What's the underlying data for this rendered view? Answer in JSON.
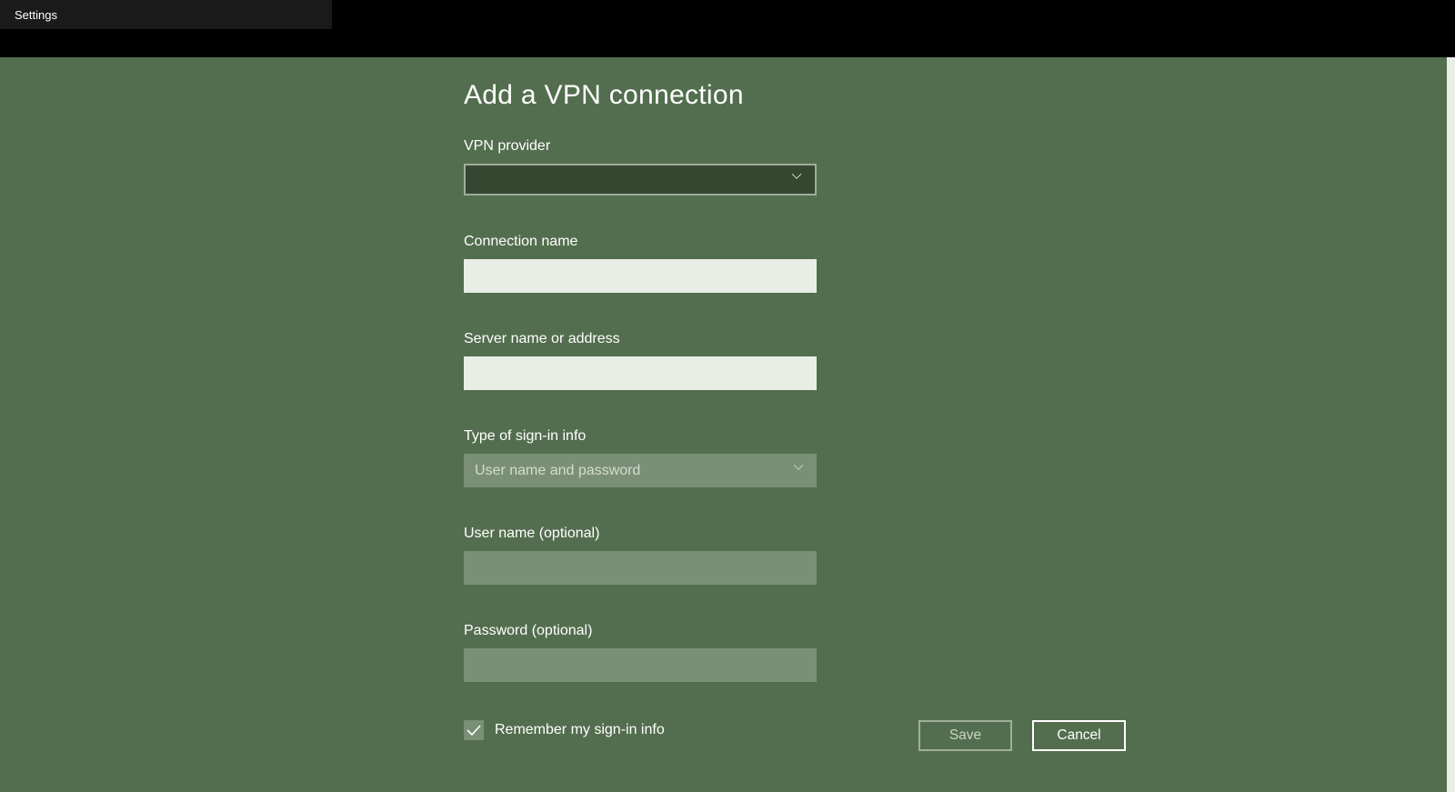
{
  "titlebar": {
    "label": "Settings"
  },
  "page": {
    "title": "Add a VPN connection"
  },
  "form": {
    "vpn_provider": {
      "label": "VPN provider",
      "value": ""
    },
    "connection_name": {
      "label": "Connection name",
      "value": ""
    },
    "server_name": {
      "label": "Server name or address",
      "value": ""
    },
    "signin_type": {
      "label": "Type of sign-in info",
      "value": "User name and password"
    },
    "username": {
      "label": "User name (optional)",
      "value": ""
    },
    "password": {
      "label": "Password (optional)",
      "value": ""
    },
    "remember": {
      "label": "Remember my sign-in info",
      "checked": true
    }
  },
  "buttons": {
    "save": "Save",
    "cancel": "Cancel"
  }
}
